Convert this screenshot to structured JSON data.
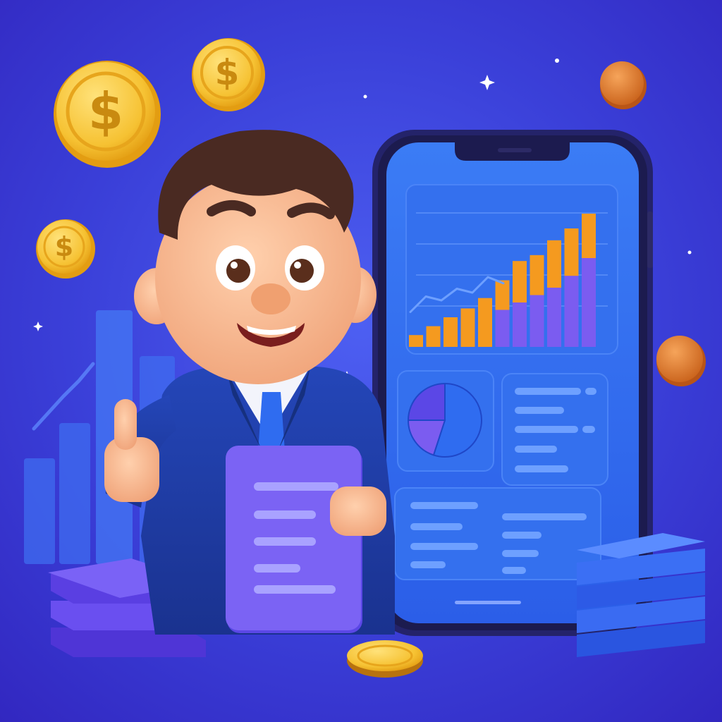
{
  "scene": {
    "description_free": true,
    "palette": {
      "background": "#3a3fd8",
      "gold": "#f6c233",
      "orange": "#f59a1f",
      "purple": "#7b5cf0",
      "phone_screen": "#2f6cf0",
      "suit": "#1f3ea8",
      "skin": "#f6b48a",
      "hair": "#4a2a22"
    },
    "coin_symbol": "$",
    "icons": [
      "dollar-coin-icon",
      "sparkle-icon",
      "pie-chart-icon",
      "bar-chart-icon",
      "document-icon"
    ]
  },
  "phone_chart": {
    "bar_heights": [
      0.08,
      0.14,
      0.2,
      0.26,
      0.33,
      0.45,
      0.58,
      0.62,
      0.72,
      0.8,
      0.9
    ],
    "bar_overlay_heights": [
      0.0,
      0.0,
      0.0,
      0.0,
      0.0,
      0.25,
      0.3,
      0.35,
      0.4,
      0.48,
      0.6
    ],
    "line_points": [
      0.25,
      0.45,
      0.4,
      0.55,
      0.5,
      0.7,
      0.62
    ]
  },
  "pie": {
    "slices": [
      0.55,
      0.2,
      0.25
    ]
  }
}
